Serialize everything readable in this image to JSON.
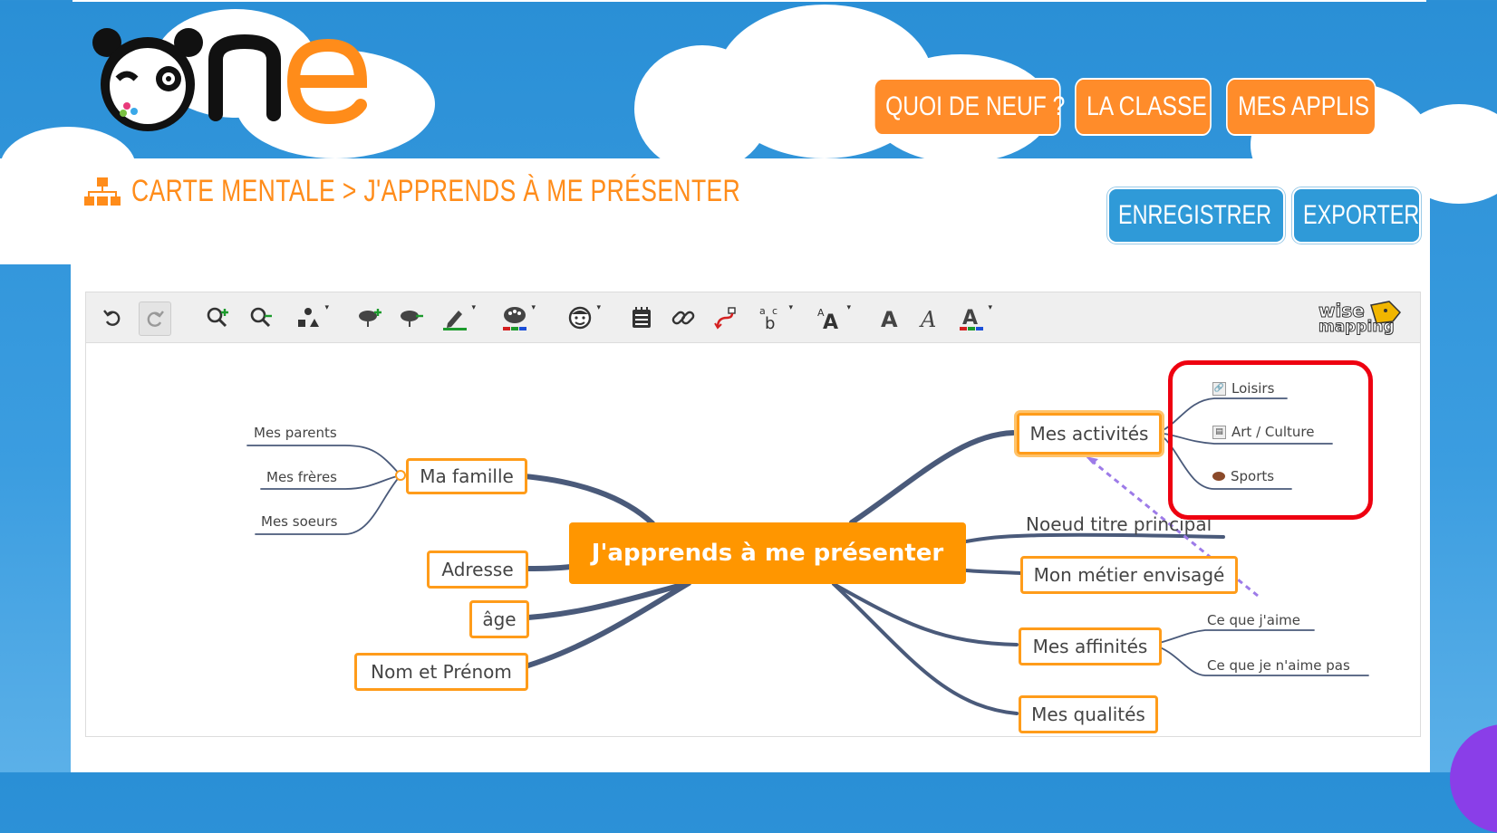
{
  "header": {
    "logo": {
      "text_n": "n",
      "text_e": "e",
      "brand_color": "#ff8c1a"
    },
    "nav": [
      "QUOI DE NEUF ?",
      "LA CLASSE",
      "MES APPLIS"
    ]
  },
  "page": {
    "title": "CARTE MENTALE > J'APPRENDS À ME PRÉSENTER",
    "title_icon": "sitemap-icon",
    "actions": {
      "save": "ENREGISTRER",
      "export": "EXPORTER"
    }
  },
  "toolbar": {
    "icons": [
      "undo-icon",
      "redo-icon",
      "zoom-in-icon",
      "zoom-out-icon",
      "shape-icon",
      "add-topic-icon",
      "delete-topic-icon",
      "border-color-icon",
      "background-color-icon",
      "emoji-icon",
      "note-icon",
      "link-icon",
      "relationship-icon",
      "font-family-icon",
      "font-size-icon",
      "bold-icon",
      "italic-icon",
      "font-color-icon"
    ],
    "brand": {
      "line1": "wise",
      "line2": "mapping"
    }
  },
  "mindmap": {
    "central": "J'apprends à me présenter",
    "left": {
      "ma_famille": "Ma famille",
      "famille_children": [
        "Mes parents",
        "Mes frères",
        "Mes soeurs"
      ],
      "adresse": "Adresse",
      "age": "âge",
      "nom": "Nom et Prénom"
    },
    "right": {
      "activites": "Mes activités",
      "activites_children": [
        "Loisirs",
        "Art / Culture",
        "Sports"
      ],
      "noeud": "Noeud titre principal",
      "metier": "Mon métier envisagé",
      "affinites": "Mes affinités",
      "affinites_children": [
        "Ce que j'aime",
        "Ce que je n'aime pas"
      ],
      "qualites": "Mes qualités"
    }
  },
  "colors": {
    "accent_orange": "#ff8c1a",
    "action_blue": "#2f9ad8",
    "highlight_red": "#ee0010",
    "connector": "#4a5a7a",
    "relationship_dashed": "#9d7be8"
  }
}
